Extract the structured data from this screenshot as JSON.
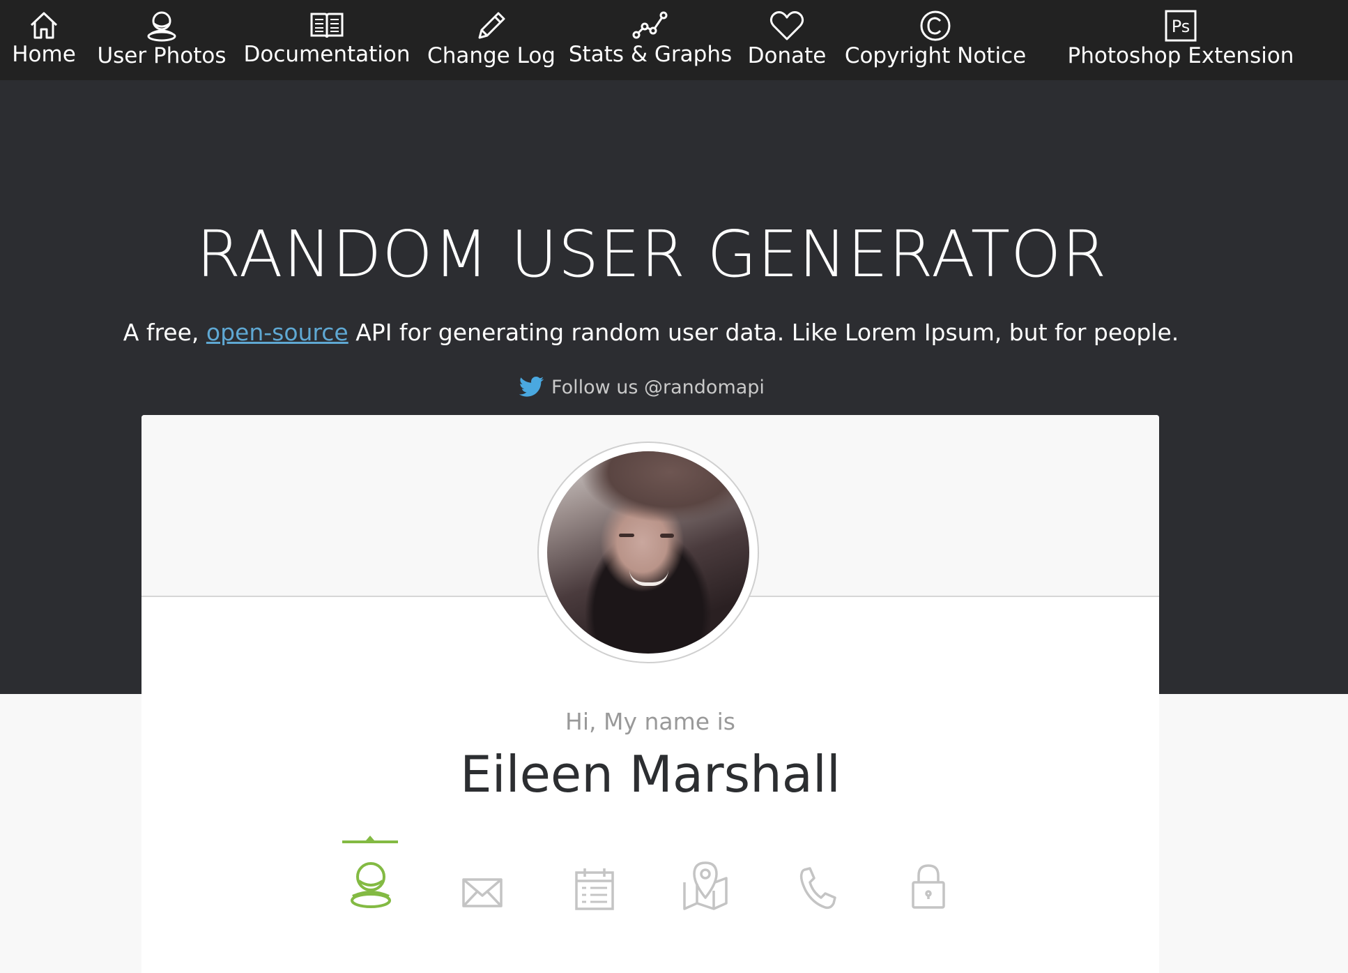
{
  "nav": {
    "items": [
      {
        "label": "Home",
        "icon": "home-icon"
      },
      {
        "label": "User Photos",
        "icon": "user-icon"
      },
      {
        "label": "Documentation",
        "icon": "book-icon"
      },
      {
        "label": "Change Log",
        "icon": "pencil-icon"
      },
      {
        "label": "Stats & Graphs",
        "icon": "graph-icon"
      },
      {
        "label": "Donate",
        "icon": "heart-icon"
      },
      {
        "label": "Copyright Notice",
        "icon": "copyright-icon"
      },
      {
        "label": "Photoshop Extension",
        "icon": "photoshop-icon"
      }
    ],
    "photoshop_icon_text": "Ps"
  },
  "hero": {
    "title": "RANDOM USER GENERATOR",
    "subtitle_before": "A free, ",
    "subtitle_link": "open-source",
    "subtitle_after": " API for generating random user data. Like Lorem Ipsum, but for people.",
    "follow_text": "Follow us @randomapi"
  },
  "card": {
    "greeting": "Hi, My name is",
    "name": "Eileen Marshall",
    "tabs": [
      {
        "icon": "user-icon",
        "active": true
      },
      {
        "icon": "mail-icon",
        "active": false
      },
      {
        "icon": "calendar-icon",
        "active": false
      },
      {
        "icon": "map-icon",
        "active": false
      },
      {
        "icon": "phone-icon",
        "active": false
      },
      {
        "icon": "lock-icon",
        "active": false
      }
    ]
  },
  "colors": {
    "nav_bg": "#222222",
    "hero_bg": "#2c2d31",
    "accent_green": "#83ba43",
    "link_blue": "#5fa8d3",
    "twitter_blue": "#4aa8e0",
    "inactive_icon": "#c4c4c4"
  }
}
